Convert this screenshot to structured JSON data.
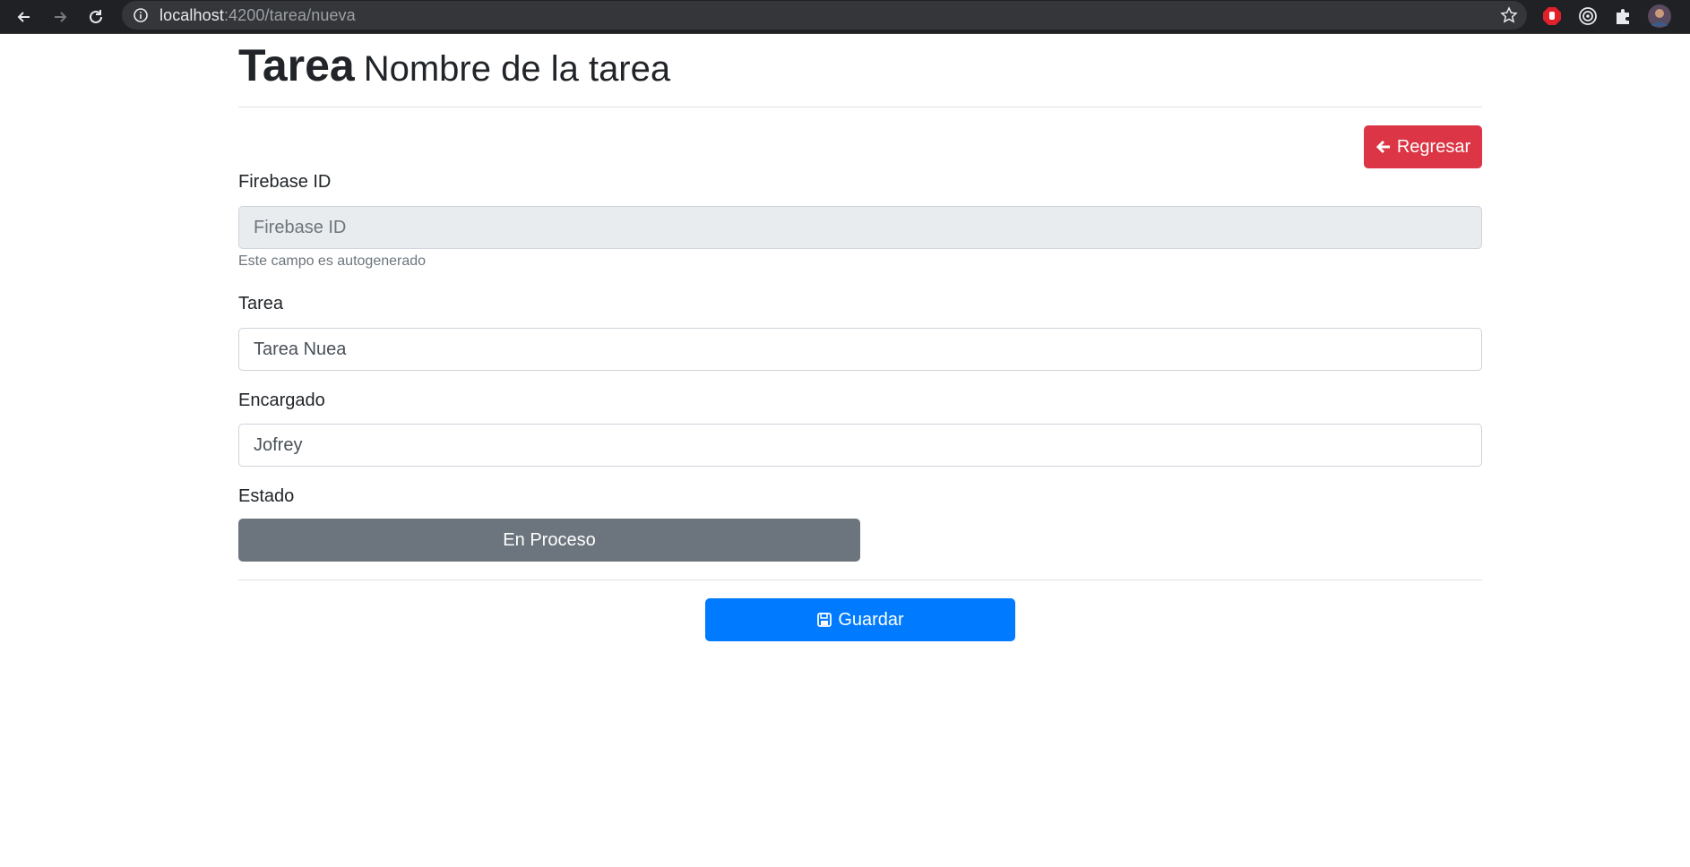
{
  "browser": {
    "url_host": "localhost",
    "url_path": ":4200/tarea/nueva"
  },
  "page": {
    "title": "Tarea",
    "subtitle": "Nombre de la tarea"
  },
  "buttons": {
    "back_label": "Regresar",
    "status_label": "En Proceso",
    "save_label": "Guardar"
  },
  "form": {
    "firebase_id": {
      "label": "Firebase ID",
      "placeholder": "Firebase ID",
      "help": "Este campo es autogenerado"
    },
    "tarea": {
      "label": "Tarea",
      "value": "Tarea Nuea"
    },
    "encargado": {
      "label": "Encargado",
      "value": "Jofrey"
    },
    "estado": {
      "label": "Estado"
    }
  },
  "colors": {
    "danger": "#dc3545",
    "secondary": "#6c757d",
    "primary": "#007bff"
  },
  "icons": [
    "back-arrow-icon",
    "forward-arrow-icon",
    "reload-icon",
    "info-icon",
    "star-icon",
    "adblock-icon",
    "extension-target-icon",
    "puzzle-icon",
    "profile-avatar",
    "arrow-left-icon",
    "save-icon"
  ]
}
